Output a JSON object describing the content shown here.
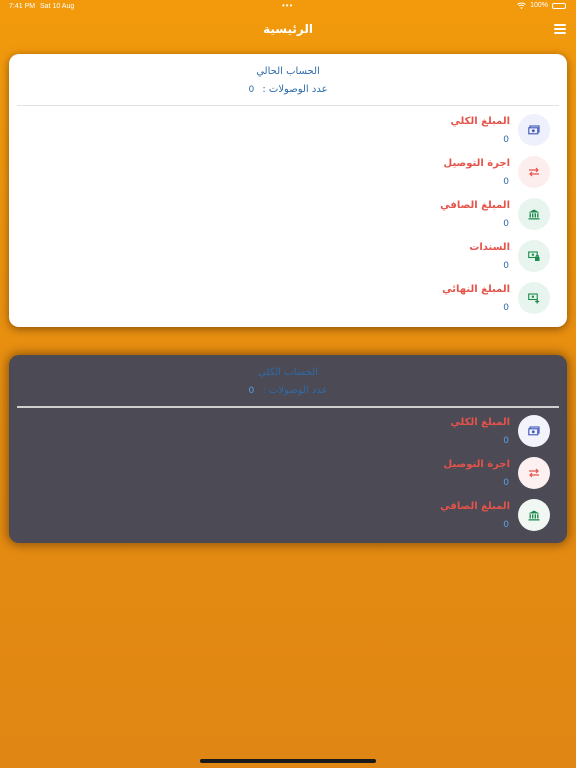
{
  "status": {
    "time": "7:41 PM",
    "date": "Sat 10 Aug",
    "battery": "100%"
  },
  "nav": {
    "title": "الرئيسية"
  },
  "current_account": {
    "title": "الحساب الحالي",
    "receipts_label": "عدد الوصولات :",
    "receipts_count": "0",
    "items": [
      {
        "label": "المبلغ الكلي",
        "value": "0",
        "icon": "money-icon"
      },
      {
        "label": "اجرة التوصيل",
        "value": "0",
        "icon": "transfer-arrows-icon"
      },
      {
        "label": "المبلغ الصافي",
        "value": "0",
        "icon": "bank-icon"
      },
      {
        "label": "السندات",
        "value": "0",
        "icon": "cash-lock-icon"
      },
      {
        "label": "المبلغ النهائي",
        "value": "0",
        "icon": "cash-plus-icon"
      }
    ]
  },
  "total_account": {
    "title": "الحساب الكلي",
    "receipts_label": "عدد الوصولات :",
    "receipts_count": "0",
    "items": [
      {
        "label": "المبلغ الكلي",
        "value": "0",
        "icon": "money-icon"
      },
      {
        "label": "اجرة التوصيل",
        "value": "0",
        "icon": "transfer-arrows-icon"
      },
      {
        "label": "المبلغ الصافي",
        "value": "0",
        "icon": "bank-icon"
      }
    ]
  },
  "colors": {
    "background": "#f29a0c",
    "label_red": "#e5534b",
    "value_blue": "#2f6aa8",
    "dark_card": "#4b4a55"
  }
}
